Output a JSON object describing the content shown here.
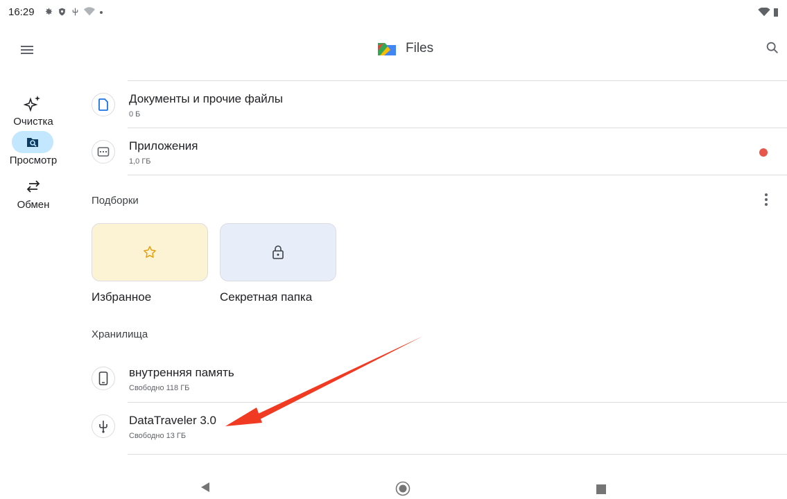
{
  "status_bar": {
    "time": "16:29"
  },
  "app_bar": {
    "title": "Files"
  },
  "nav_rail": {
    "items": [
      {
        "label": "Очистка",
        "icon": "sparkle-icon",
        "active": false
      },
      {
        "label": "Просмотр",
        "icon": "browse-icon",
        "active": true
      },
      {
        "label": "Обмен",
        "icon": "swap-icon",
        "active": false
      }
    ]
  },
  "categories": [
    {
      "title": "Документы и прочие файлы",
      "subtitle": "0 Б",
      "icon": "document-icon"
    },
    {
      "title": "Приложения",
      "subtitle": "1,0 ГБ",
      "icon": "apps-icon",
      "badge_color": "#e8554b"
    }
  ],
  "collections": {
    "header": "Подборки",
    "cards": [
      {
        "label": "Избранное",
        "icon": "star-icon",
        "color": "#fcf2d4"
      },
      {
        "label": "Секретная папка",
        "icon": "lock-icon",
        "color": "#e8edfa"
      }
    ]
  },
  "storage": {
    "header": "Хранилища",
    "items": [
      {
        "title": "внутренняя память",
        "subtitle": "Свободно 118 ГБ",
        "icon": "phone-icon"
      },
      {
        "title": "DataTraveler 3.0",
        "subtitle": "Свободно 13 ГБ",
        "icon": "usb-icon"
      }
    ]
  },
  "annotation": {
    "color": "#f03a22"
  }
}
